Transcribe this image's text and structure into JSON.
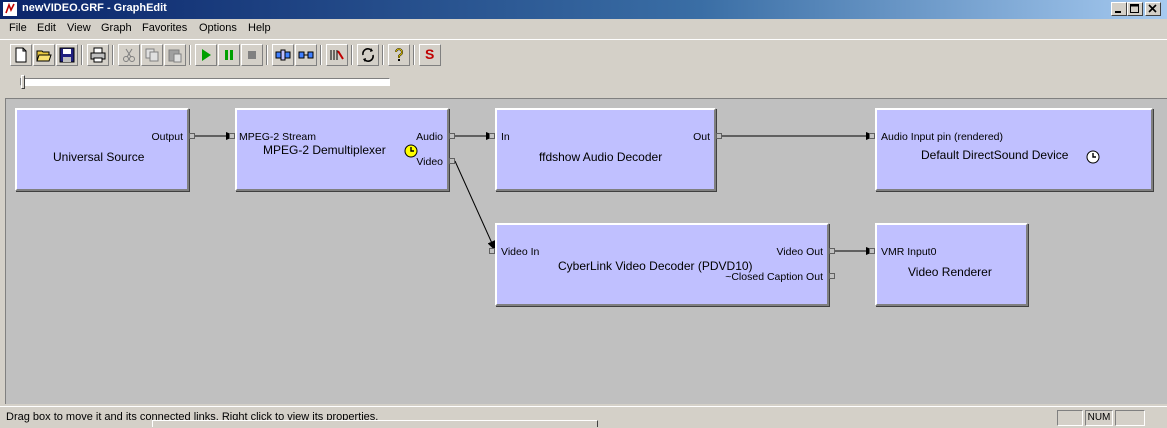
{
  "window": {
    "title": "newVIDEO.GRF - GraphEdit",
    "icon": "graphedit-icon"
  },
  "menu": [
    "File",
    "Edit",
    "View",
    "Graph",
    "Favorites",
    "Options",
    "Help"
  ],
  "toolbar": {
    "buttons": [
      "new-icon",
      "open-icon",
      "save-icon",
      "print-icon",
      "cut-icon",
      "copy-icon",
      "paste-icon",
      "play-icon",
      "pause-icon",
      "stop-icon",
      "seek-icon",
      "frame-step-icon",
      "sync-icon",
      "refresh-icon",
      "help-icon",
      "stats-icon"
    ],
    "stats_letter": "S"
  },
  "seek": {
    "position": 0
  },
  "graph": {
    "filters": [
      {
        "name": "Universal Source",
        "pins": [
          "Output"
        ]
      },
      {
        "name": "MPEG-2 Demultiplexer",
        "pins": [
          "MPEG-2 Stream",
          "Audio",
          "Video"
        ],
        "clock": true
      },
      {
        "name": "ffdshow Audio Decoder",
        "pins": [
          "In",
          "Out"
        ]
      },
      {
        "name": "Default DirectSound Device",
        "pins": [
          "Audio Input pin (rendered)"
        ],
        "clock": true
      },
      {
        "name": "CyberLink Video Decoder (PDVD10)",
        "pins": [
          "Video In",
          "Video Out",
          "~Closed Caption Out"
        ]
      },
      {
        "name": "Video Renderer",
        "pins": [
          "VMR Input0"
        ]
      }
    ]
  },
  "status": {
    "text": "Drag box to move it and its connected links. Right click to view its properties.",
    "num": "NUM"
  },
  "colors": {
    "filter_fill": "#c0c0ff",
    "canvas": "#c0c0c0",
    "chrome": "#d4d0c8",
    "title_start": "#0a246a"
  }
}
